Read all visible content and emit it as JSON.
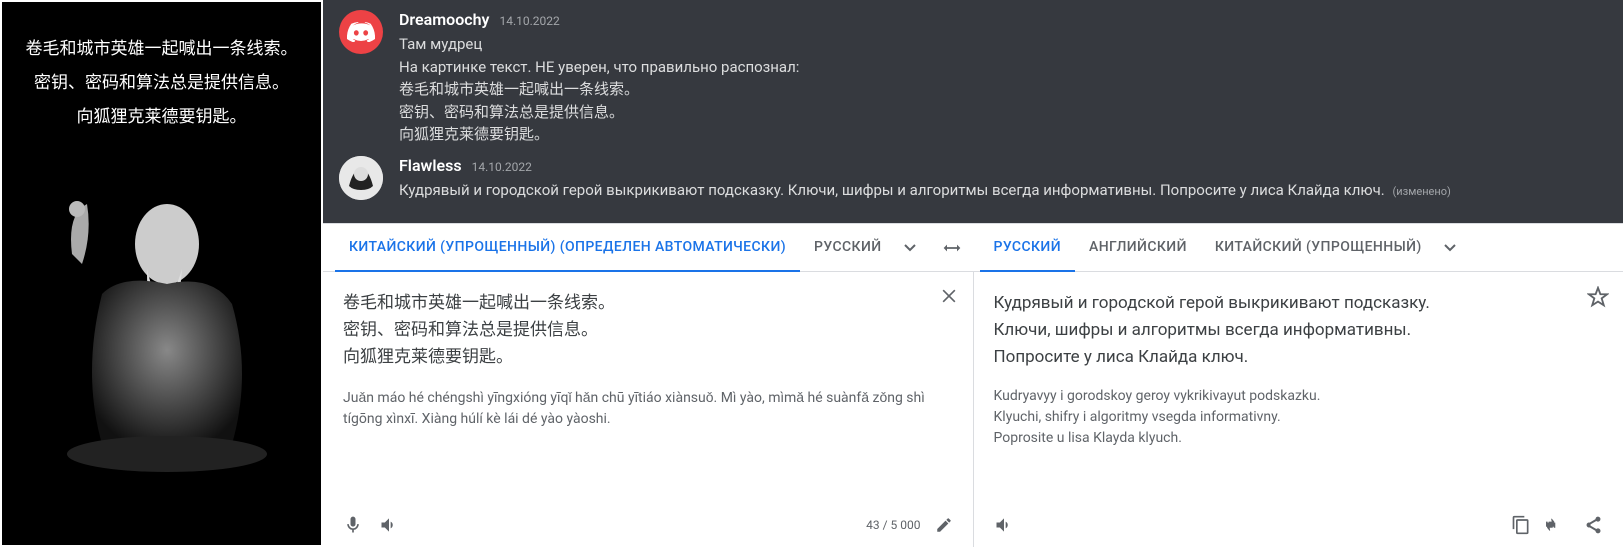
{
  "left_image": {
    "line1": "卷毛和城市英雄一起喊出一条线索。",
    "line2": "密钥、密码和算法总是提供信息。",
    "line3": "向狐狸克莱德要钥匙。"
  },
  "discord": {
    "msg1": {
      "user": "Dreamoochy",
      "date": "14.10.2022",
      "line1": "Там мудрец",
      "line2": "На картинке текст. НЕ уверен, что правильно распознал:",
      "line3": "卷毛和城市英雄一起喊出一条线索。",
      "line4": "密钥、密码和算法总是提供信息。",
      "line5": "向狐狸克莱德要钥匙。"
    },
    "msg2": {
      "user": "Flawless",
      "date": "14.10.2022",
      "text": "Кудрявый и городской герой выкрикивают подсказку. Ключи, шифры и алгоритмы всегда информативны. Попросите у лиса Клайда ключ.",
      "edited": "(изменено)"
    }
  },
  "translate": {
    "tabs_left": {
      "detected": "КИТАЙСКИЙ (УПРОЩЕННЫЙ) (ОПРЕДЕЛЕН АВТОМАТИЧЕСКИ)",
      "russian": "РУССКИЙ"
    },
    "tabs_right": {
      "russian": "РУССКИЙ",
      "english": "АНГЛИЙСКИЙ",
      "chinese": "КИТАЙСКИЙ (УПРОЩЕННЫЙ)"
    },
    "input": {
      "line1": "卷毛和城市英雄一起喊出一条线索。",
      "line2": "密钥、密码和算法总是提供信息。",
      "line3": "向狐狸克莱德要钥匙。"
    },
    "pinyin": "Juǎn máo hé chéngshì yīngxióng yīqǐ hǎn chū yītiáo xiànsuǒ. Mì yào, mìmǎ hé suànfǎ zǒng shì tígōng xìnxī. Xiàng húlí kè lái dé yào yàoshi.",
    "counter": "43 / 5 000",
    "output": {
      "line1": "Кудрявый и городской герой выкрикивают подсказку.",
      "line2": "Ключи, шифры и алгоритмы всегда информативны.",
      "line3": "Попросите у лиса Клайда ключ."
    },
    "translit": {
      "line1": "Kudryavyy i gorodskoy geroy vykrikivayut podskazku.",
      "line2": "Klyuchi, shifry i algoritmy vsegda informativny.",
      "line3": "Poprosite u lisa Klayda klyuch."
    }
  }
}
